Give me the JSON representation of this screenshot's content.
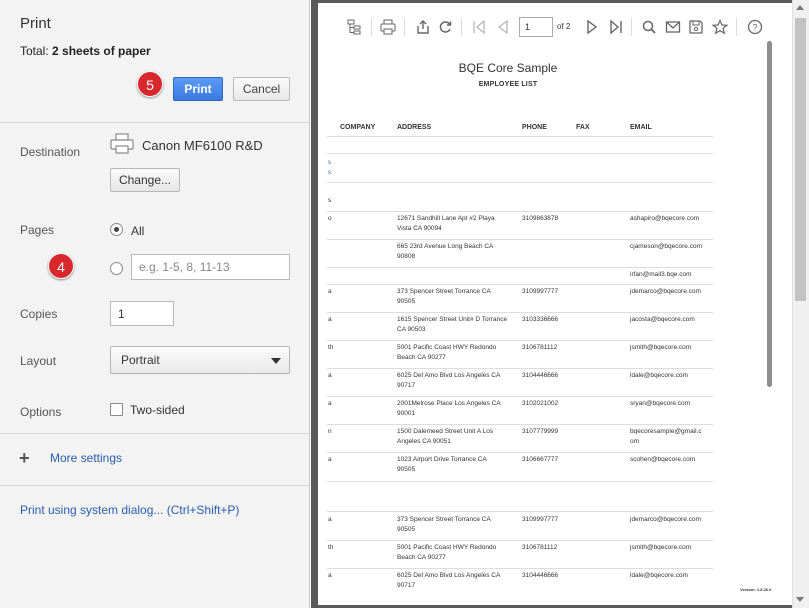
{
  "dialog": {
    "title": "Print",
    "total_prefix": "Total: ",
    "total_value": "2 sheets of paper"
  },
  "actions": {
    "print_label": "Print",
    "cancel_label": "Cancel"
  },
  "badges": {
    "print_step": "5",
    "pages_step": "4"
  },
  "destination": {
    "label": "Destination",
    "printer": "Canon MF6100 R&D",
    "change_label": "Change..."
  },
  "pages": {
    "label": "Pages",
    "all_label": "All",
    "custom_placeholder": "e.g. 1-5, 8, 11-13",
    "selected": "All"
  },
  "copies": {
    "label": "Copies",
    "value": "1"
  },
  "layout": {
    "label": "Layout",
    "value": "Portrait"
  },
  "options": {
    "label": "Options",
    "two_sided_label": "Two-sided",
    "two_sided_checked": false
  },
  "more_settings": "More settings",
  "system_dialog": "Print using system dialog... (Ctrl+Shift+P)",
  "preview": {
    "toolbar_icons": [
      "tree-icon",
      "printer-icon",
      "share-icon",
      "refresh-icon",
      "first-page-icon",
      "prev-page-icon",
      "next-page-icon",
      "last-page-icon",
      "search-icon",
      "mail-icon",
      "save-icon",
      "star-icon",
      "help-icon"
    ],
    "current_page": "1",
    "page_of": "of 2",
    "doc_title": "BQE Core Sample",
    "doc_subtitle": "EMPLOYEE LIST",
    "columns": [
      "COMPANY",
      "ADDRESS",
      "PHONE",
      "FAX",
      "EMAIL"
    ],
    "rows": [
      {
        "left": "o",
        "address1": "12671 Sandhill Lane Apt #2 Playa",
        "address2": "Vista CA 90094",
        "phone": "3109863878",
        "email1": "ashapiro@bqecore.com",
        "email2": ""
      },
      {
        "left": "",
        "address1": "665 23rd Avenue  Long Beach CA",
        "address2": "90808",
        "phone": "",
        "email1": "cjameson@bqecore.com",
        "email2": ""
      },
      {
        "left": "",
        "address1": "",
        "address2": "",
        "phone": "",
        "email1": "irfan@mail3.bqe.com",
        "email2": ""
      },
      {
        "left": "a",
        "address1": "373 Spencer Street  Torrance CA",
        "address2": "90505",
        "phone": "3109997777",
        "email1": "jdemarco@bqecore.com",
        "email2": ""
      },
      {
        "left": "a",
        "address1": "1615 Spencer Street Unit# D Torrance",
        "address2": "CA 90503",
        "phone": "3103336666",
        "email1": "jacosta@bqecore.com",
        "email2": ""
      },
      {
        "left": "th",
        "address1": "5001 Pacific Coast HWY  Redondo",
        "address2": "Beach CA 90277",
        "phone": "3106781112",
        "email1": "jsmith@bqecore.com",
        "email2": ""
      },
      {
        "left": "a",
        "address1": "6025 Del Amo Blvd  Los Angeles CA",
        "address2": "90717",
        "phone": "3104446666",
        "email1": "ldale@bqecore.com",
        "email2": ""
      },
      {
        "left": "a",
        "address1": "2001Melrose Place  Los Angeles CA",
        "address2": "90001",
        "phone": "3102021002",
        "email1": "sryan@bqecore.com",
        "email2": ""
      },
      {
        "left": "n",
        "address1": "1500 Dalemeed Street Unit A Los",
        "address2": "Angeles CA 90051",
        "phone": "3107779999",
        "email1": "bqecoresample@gmail.c",
        "email2": "om"
      },
      {
        "left": "a",
        "address1": "1023 Airport Drive  Torrance CA",
        "address2": "90505",
        "phone": "3106667777",
        "email1": "scohen@bqecore.com",
        "email2": ""
      },
      {
        "left": "a",
        "address1": "373 Spencer Street  Torrance CA",
        "address2": "90505",
        "phone": "3109997777",
        "email1": "jdemarco@bqecore.com",
        "email2": ""
      },
      {
        "left": "th",
        "address1": "5001 Pacific Coast HWY  Redondo",
        "address2": "Beach CA 90277",
        "phone": "3106781112",
        "email1": "jsmith@bqecore.com",
        "email2": ""
      },
      {
        "left": "a",
        "address1": "6025 Del Amo Blvd  Los Angeles CA",
        "address2": "90717",
        "phone": "3104446666",
        "email1": "ldale@bqecore.com",
        "email2": ""
      }
    ],
    "blue_marks": [
      "s",
      "s"
    ],
    "early_mark": "s",
    "version": "Version: 1.8.26.0"
  },
  "colors": {
    "primary_button": "#3b7be0",
    "badge": "#d8272d",
    "link": "#2a5db0",
    "panel_bg": "#f3f3f3",
    "preview_bg": "#5a5a5a"
  }
}
